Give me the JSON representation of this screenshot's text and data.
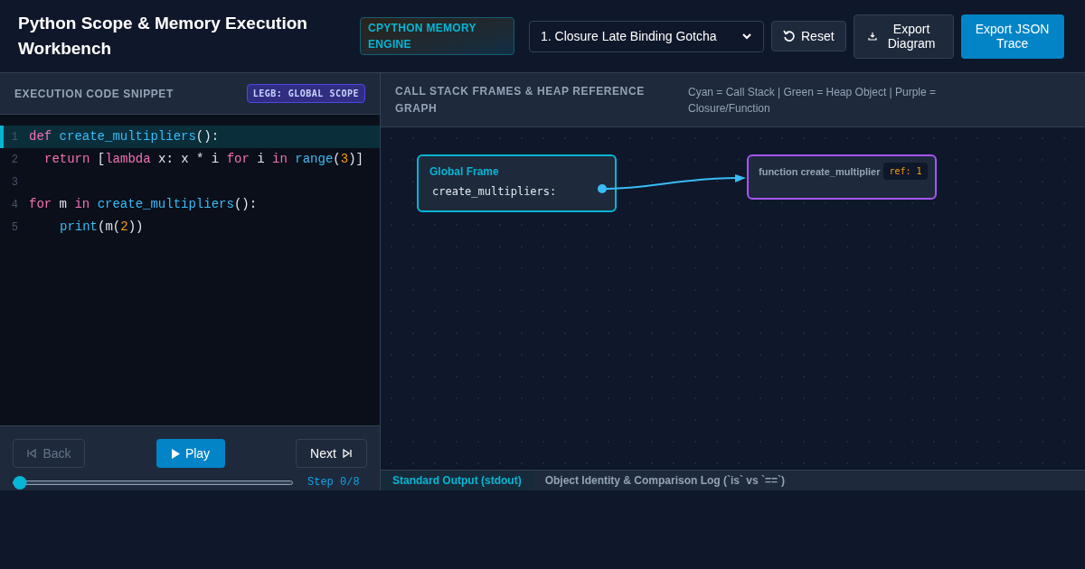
{
  "header": {
    "title": "Python Scope & Memory Execution Workbench",
    "engine_badge": "CPYTHON MEMORY ENGINE",
    "scenario_select": "1. Closure Late Binding Gotcha",
    "buttons": [
      {
        "kind": "reset",
        "label": "Reset"
      },
      {
        "kind": "export",
        "label": "Export Diagram"
      },
      {
        "kind": "primary",
        "label": "Export JSON Trace"
      }
    ]
  },
  "code_panel": {
    "title": "EXECUTION CODE SNIPPET",
    "scope_badge": "LEGB: GLOBAL SCOPE",
    "lines": [
      {
        "number": "1",
        "selected": true,
        "kind": "top",
        "tokens": [
          {
            "kind": "kw",
            "text": "def "
          },
          {
            "kind": "fn",
            "text": "create_multipliers"
          },
          {
            "kind": "plain",
            "text": "():"
          }
        ]
      },
      {
        "number": "2",
        "selected": false,
        "kind": "body",
        "tokens": [
          {
            "kind": "kw",
            "text": "return "
          },
          {
            "kind": "plain",
            "text": "["
          },
          {
            "kind": "kw",
            "text": "lambda "
          },
          {
            "kind": "plain",
            "text": "x: x * i "
          },
          {
            "kind": "kw",
            "text": "for "
          },
          {
            "kind": "plain",
            "text": "i "
          },
          {
            "kind": "kw",
            "text": "in "
          },
          {
            "kind": "fn",
            "text": "range"
          },
          {
            "kind": "plain",
            "text": "("
          },
          {
            "kind": "num",
            "text": "3"
          },
          {
            "kind": "plain",
            "text": ")]"
          }
        ]
      },
      {
        "number": "3",
        "selected": false
      },
      {
        "number": "4",
        "selected": false,
        "kind": "top",
        "tokens": [
          {
            "kind": "kw",
            "text": "for "
          },
          {
            "kind": "plain",
            "text": "m "
          },
          {
            "kind": "kw",
            "text": "in "
          },
          {
            "kind": "fn",
            "text": "create_multipliers"
          },
          {
            "kind": "plain",
            "text": "():"
          }
        ]
      },
      {
        "number": "5",
        "selected": false,
        "kind": "deep",
        "tokens": [
          {
            "kind": "fn",
            "text": "print"
          },
          {
            "kind": "plain",
            "text": "(m("
          },
          {
            "kind": "num",
            "text": "2"
          },
          {
            "kind": "plain",
            "text": "))"
          }
        ]
      }
    ],
    "controls": {
      "back": {
        "label": "Back",
        "disabled": true
      },
      "play": {
        "label": "Play"
      },
      "next": {
        "label": "Next",
        "disabled": false
      },
      "step_slider": {
        "level": 0
      },
      "step_label": "Step 0/8"
    }
  },
  "graph_panel": {
    "title": "CALL STACK FRAMES & HEAP REFERENCE GRAPH",
    "legend": "Cyan = Call Stack | Green = Heap Object | Purple = Closure/Function",
    "global_frame": {
      "title": "Global Frame",
      "variables": [
        {
          "name": "create_multipliers:"
        }
      ]
    },
    "heap_objects": [
      {
        "kind": "function",
        "label": "function create_multiplier",
        "ref": "ref: 1"
      }
    ],
    "output_tabs": [
      {
        "label": "Standard Output (stdout)",
        "selected": true
      },
      {
        "label": "Object Identity & Comparison Log (`is` vs `==`)",
        "selected": false
      }
    ]
  }
}
